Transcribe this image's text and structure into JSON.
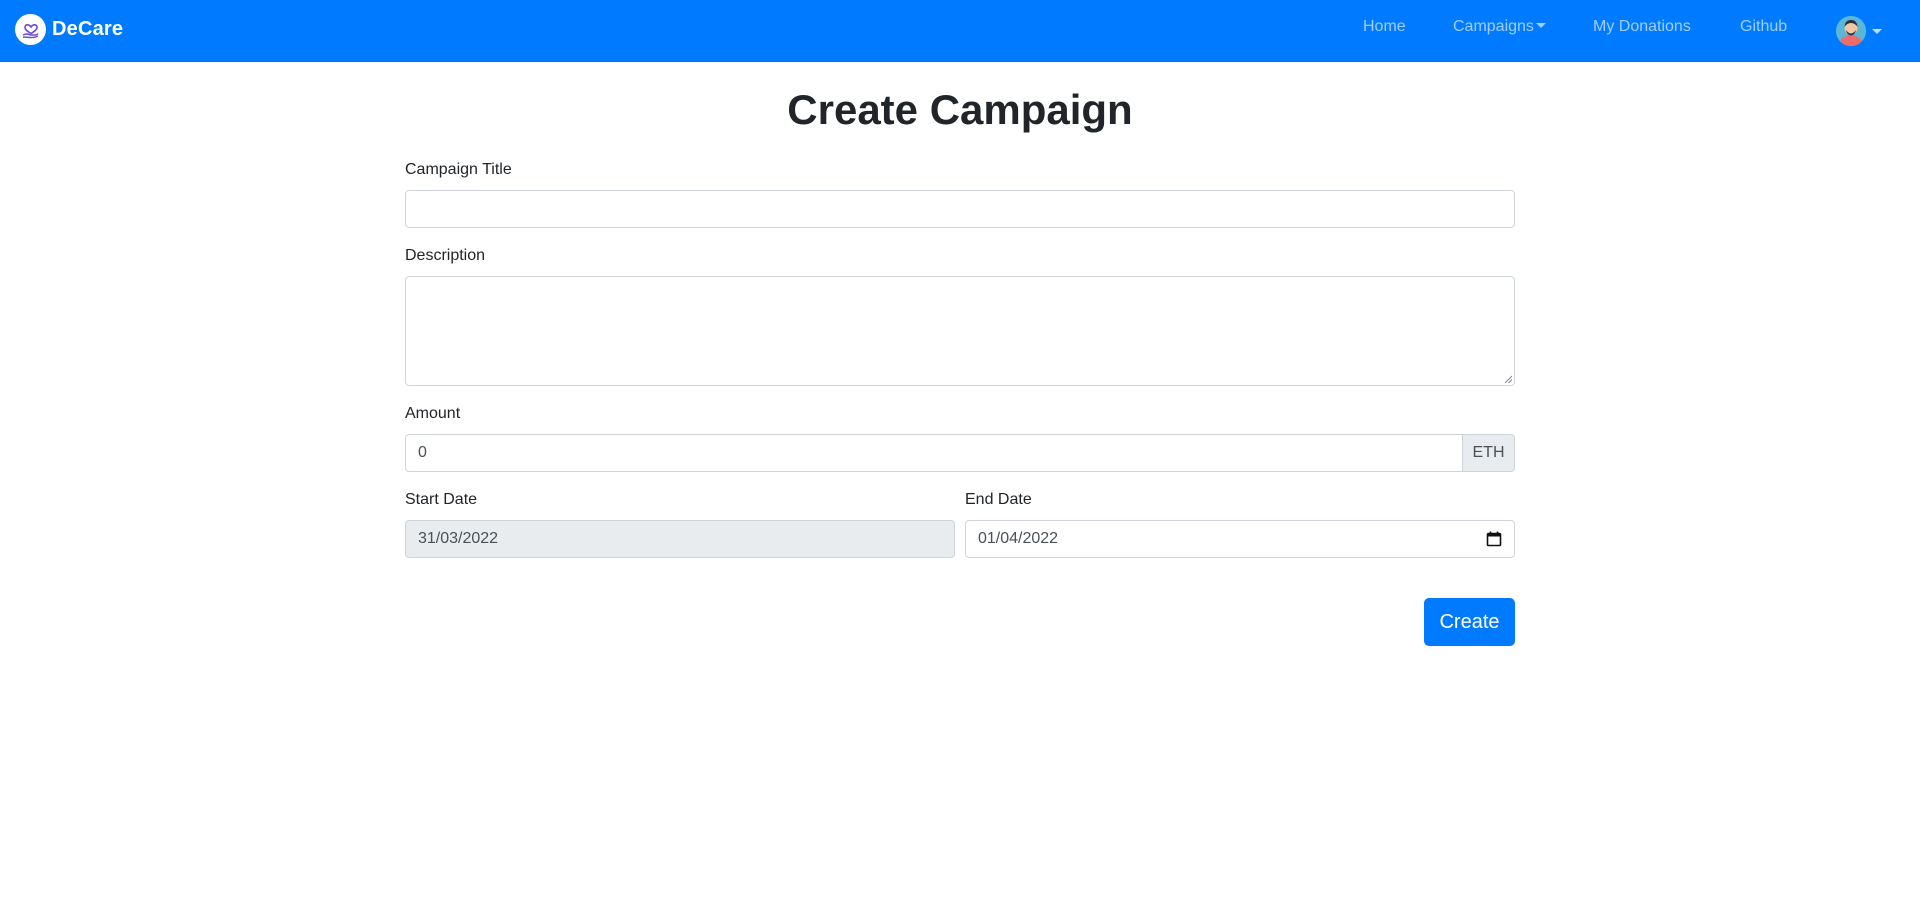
{
  "navbar": {
    "brand": "DeCare",
    "links": {
      "home": "Home",
      "campaigns": "Campaigns",
      "my_donations": "My Donations",
      "github": "Github"
    }
  },
  "form": {
    "title": "Create Campaign",
    "campaign_title_label": "Campaign Title",
    "campaign_title_value": "",
    "description_label": "Description",
    "description_value": "",
    "amount_label": "Amount",
    "amount_value": "0",
    "amount_unit": "ETH",
    "start_date_label": "Start Date",
    "start_date_value": "31/03/2022",
    "end_date_label": "End Date",
    "end_date_value": "01/04/2022",
    "submit_label": "Create"
  },
  "colors": {
    "navbar": "#007bff",
    "primary": "#007bff",
    "readonly_bg": "#e9ecef"
  }
}
